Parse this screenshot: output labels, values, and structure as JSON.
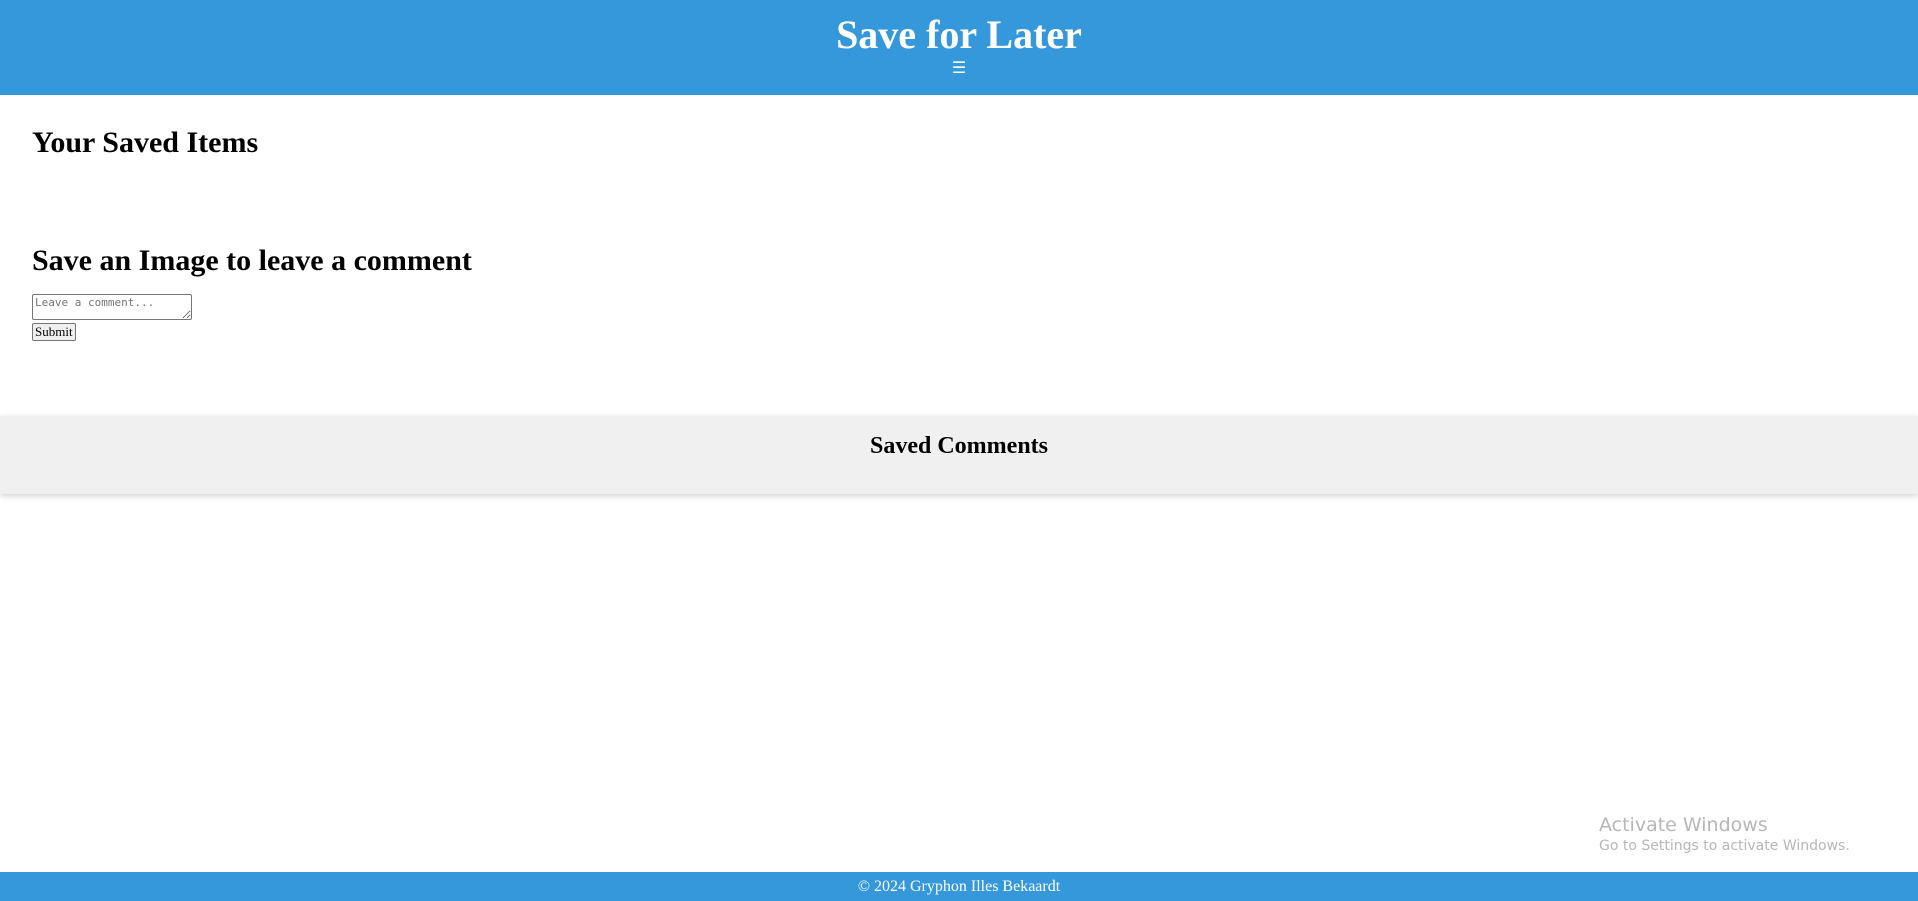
{
  "header": {
    "title": "Save for Later",
    "menu_icon": "☰"
  },
  "main": {
    "saved_items_heading": "Your Saved Items",
    "comment_heading": "Save an Image to leave a comment",
    "comment_placeholder": "Leave a comment...",
    "comment_value": "",
    "submit_label": "Submit"
  },
  "saved_comments": {
    "heading": "Saved Comments"
  },
  "os_watermark": {
    "line1": "Activate Windows",
    "line2": "Go to Settings to activate Windows."
  },
  "footer": {
    "text": "© 2024 Gryphon Illes Bekaardt"
  },
  "colors": {
    "brand": "#3498db",
    "panel": "#f0f0f0"
  }
}
